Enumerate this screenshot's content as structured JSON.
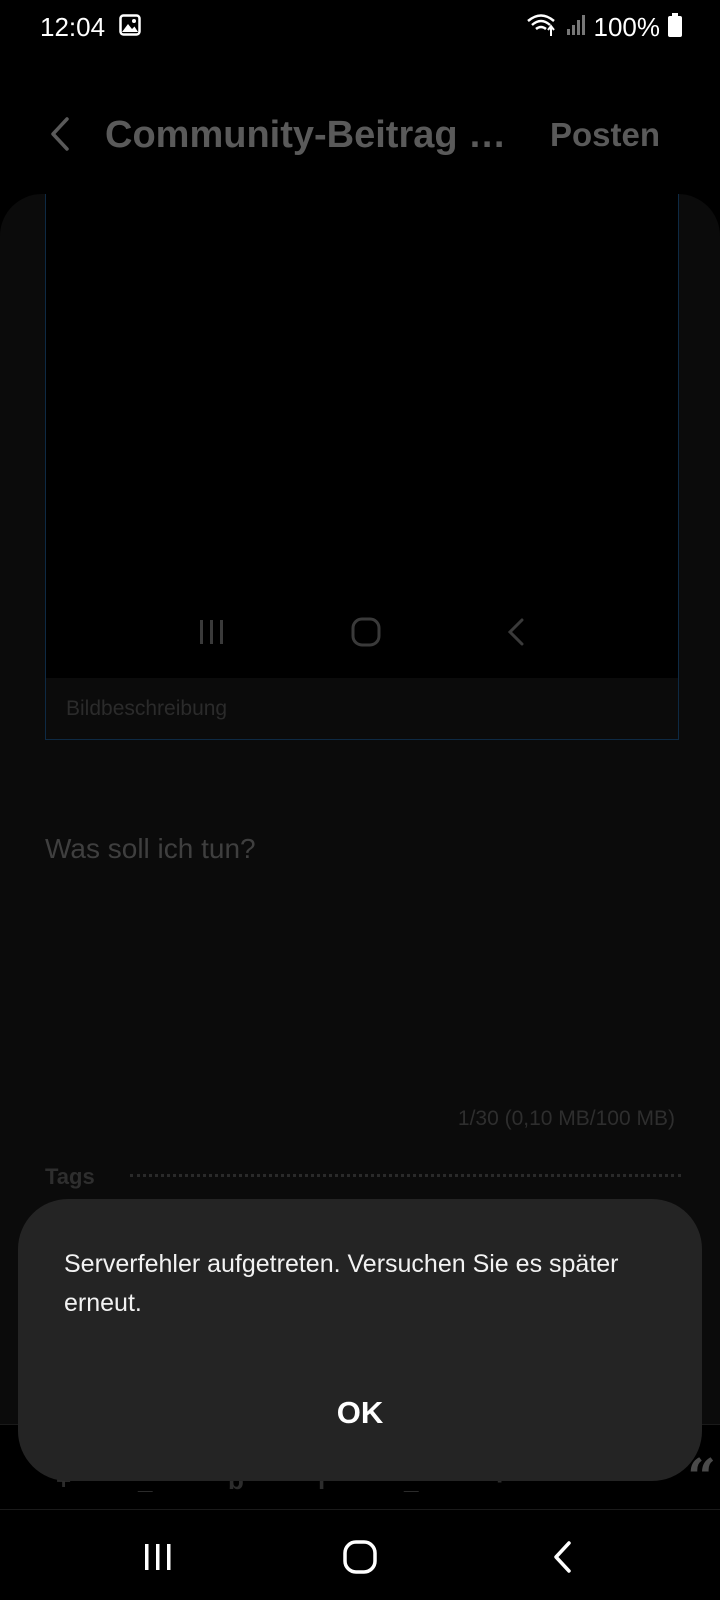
{
  "status_bar": {
    "time": "12:04",
    "battery": "100%",
    "icons": [
      "gallery-notification-icon",
      "wifi-icon",
      "signal-icon",
      "battery-icon"
    ]
  },
  "app_bar": {
    "title": "Community-Beitrag sc...",
    "post_label": "Posten"
  },
  "editor": {
    "image_caption_placeholder": "Bildbeschreibung",
    "body_placeholder": "Was soll ich tun?",
    "attachment_counter": "1/30 (0,10 MB/100 MB)",
    "tags_label": "Tags"
  },
  "dialog": {
    "message": "Serverfehler aufgetreten. Versuchen Sie es später erneut.",
    "ok_label": "OK"
  },
  "colors": {
    "background": "#000000",
    "card": "#0b0b0b",
    "dialog": "#242424",
    "dimmed_text": "#5a5a5a"
  }
}
